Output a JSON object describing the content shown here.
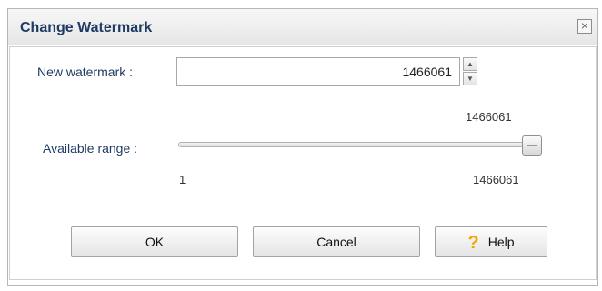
{
  "dialog": {
    "title": "Change Watermark",
    "close_glyph": "×"
  },
  "form": {
    "new_watermark_label": "New watermark :",
    "new_watermark_value": "1466061",
    "current_value_display": "1466061",
    "available_range_label": "Available range :",
    "range_min": "1",
    "range_max": "1466061",
    "slider_level_fraction": 1.0
  },
  "buttons": {
    "ok": "OK",
    "cancel": "Cancel",
    "help": "Help",
    "help_icon": "question-mark-icon"
  },
  "colors": {
    "label_text": "#1f3b63",
    "help_icon": "#f0a800"
  }
}
